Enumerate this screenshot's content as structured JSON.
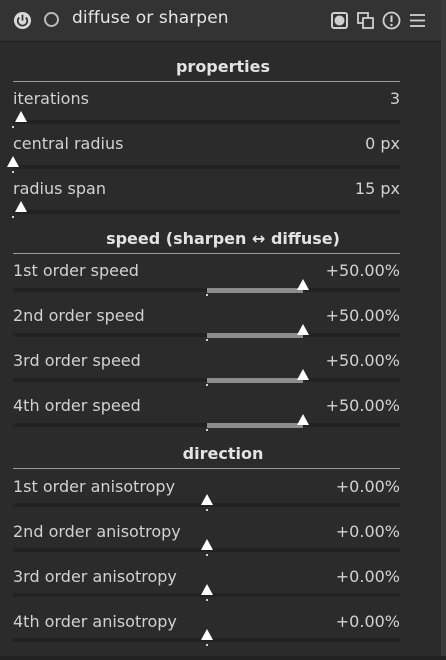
{
  "header": {
    "title": "diffuse or sharpen",
    "icons": [
      "power-icon",
      "preset-indicator-icon",
      "mask-icon",
      "multi-instance-icon",
      "reset-icon",
      "presets-menu-icon"
    ]
  },
  "sections": {
    "properties": "properties",
    "speed": "speed (sharpen ↔ diffuse)",
    "direction": "direction"
  },
  "sliders": {
    "iterations": {
      "label": "iterations",
      "value": "3",
      "level": 0.02
    },
    "central_radius": {
      "label": "central radius",
      "value": "0 px",
      "level": 0.0
    },
    "radius_span": {
      "label": "radius span",
      "value": "15 px",
      "level": 0.02
    },
    "speed1": {
      "label": "1st order speed",
      "value": "+50.00%",
      "level": 0.75
    },
    "speed2": {
      "label": "2nd order speed",
      "value": "+50.00%",
      "level": 0.75
    },
    "speed3": {
      "label": "3rd order speed",
      "value": "+50.00%",
      "level": 0.75
    },
    "speed4": {
      "label": "4th order speed",
      "value": "+50.00%",
      "level": 0.75
    },
    "aniso1": {
      "label": "1st order anisotropy",
      "value": "+0.00%",
      "level": 0.5
    },
    "aniso2": {
      "label": "2nd order anisotropy",
      "value": "+0.00%",
      "level": 0.5
    },
    "aniso3": {
      "label": "3rd order anisotropy",
      "value": "+0.00%",
      "level": 0.5
    },
    "aniso4": {
      "label": "4th order anisotropy",
      "value": "+0.00%",
      "level": 0.5
    }
  },
  "colors": {
    "background": "#2b2b2b",
    "header": "#333333",
    "text": "#d2d2d2",
    "fill": "#8c8c8c",
    "thumb": "#ffffff"
  }
}
